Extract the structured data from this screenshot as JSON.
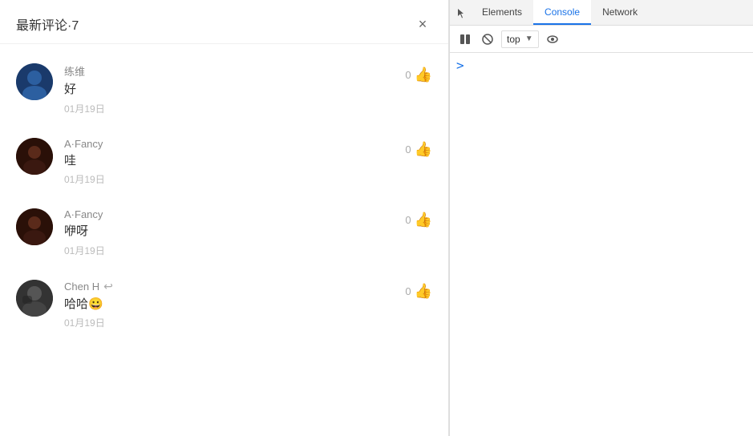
{
  "comments_panel": {
    "title": "最新评论·7",
    "close_label": "×",
    "comments": [
      {
        "id": "1",
        "username": "练维",
        "reply_icon": null,
        "text": "好",
        "date": "01月19日",
        "likes": "0",
        "avatar_type": "lianwei"
      },
      {
        "id": "2",
        "username": "A·Fancy",
        "reply_icon": null,
        "text": "哇",
        "date": "01月19日",
        "likes": "0",
        "avatar_type": "afancy1"
      },
      {
        "id": "3",
        "username": "A·Fancy",
        "reply_icon": null,
        "text": "咿呀",
        "date": "01月19日",
        "likes": "0",
        "avatar_type": "afancy2"
      },
      {
        "id": "4",
        "username": "Chen H",
        "reply_icon": "↩",
        "text": "哈哈😀",
        "date": "01月19日",
        "likes": "0",
        "avatar_type": "chenh"
      }
    ]
  },
  "devtools": {
    "tabs": [
      {
        "label": "Elements",
        "active": false
      },
      {
        "label": "Console",
        "active": true
      },
      {
        "label": "Network",
        "active": false
      }
    ],
    "toolbar": {
      "context_label": "top",
      "dropdown_icon": "▼"
    },
    "console": {
      "caret": ">"
    }
  }
}
